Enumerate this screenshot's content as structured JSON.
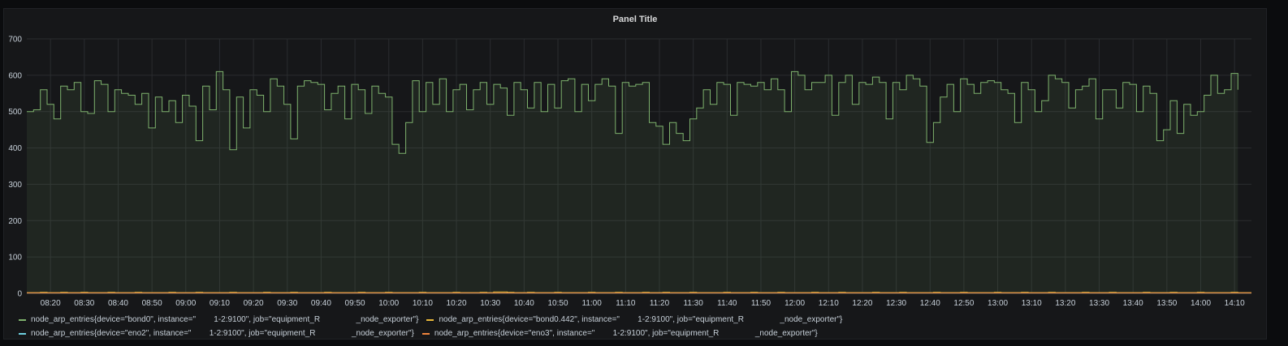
{
  "panel": {
    "title": "Panel Title"
  },
  "colors": {
    "background": "#161719",
    "grid": "#2a2c2f",
    "bond0": "#7eb26d",
    "bond0_442": "#eab839",
    "eno2": "#6ed0e0",
    "eno3": "#ef843c"
  },
  "chart_data": {
    "type": "line",
    "title": "Panel Title",
    "xlabel": "",
    "ylabel": "",
    "xlim": [
      "08:13",
      "14:15"
    ],
    "ylim": [
      0,
      700
    ],
    "y_ticks": [
      "0",
      "100",
      "200",
      "300",
      "400",
      "500",
      "600",
      "700"
    ],
    "x_ticks": [
      "08:20",
      "08:30",
      "08:40",
      "08:50",
      "09:00",
      "09:10",
      "09:20",
      "09:30",
      "09:40",
      "09:50",
      "10:00",
      "10:10",
      "10:20",
      "10:30",
      "10:40",
      "10:50",
      "11:00",
      "11:10",
      "11:20",
      "11:30",
      "11:40",
      "11:50",
      "12:00",
      "12:10",
      "12:20",
      "12:30",
      "12:40",
      "12:50",
      "13:00",
      "13:10",
      "13:20",
      "13:30",
      "13:40",
      "13:50",
      "14:00",
      "14:10"
    ],
    "grid": true,
    "legend_position": "bottom",
    "x": [
      "08:13",
      "08:15",
      "08:17",
      "08:19",
      "08:21",
      "08:23",
      "08:25",
      "08:27",
      "08:29",
      "08:31",
      "08:33",
      "08:35",
      "08:37",
      "08:39",
      "08:41",
      "08:43",
      "08:45",
      "08:47",
      "08:49",
      "08:51",
      "08:53",
      "08:55",
      "08:57",
      "08:59",
      "09:01",
      "09:03",
      "09:05",
      "09:07",
      "09:09",
      "09:11",
      "09:13",
      "09:15",
      "09:17",
      "09:19",
      "09:21",
      "09:23",
      "09:25",
      "09:27",
      "09:29",
      "09:31",
      "09:33",
      "09:35",
      "09:37",
      "09:39",
      "09:41",
      "09:43",
      "09:45",
      "09:47",
      "09:49",
      "09:51",
      "09:53",
      "09:55",
      "09:57",
      "09:59",
      "10:01",
      "10:03",
      "10:05",
      "10:07",
      "10:09",
      "10:11",
      "10:13",
      "10:15",
      "10:17",
      "10:19",
      "10:21",
      "10:23",
      "10:25",
      "10:27",
      "10:29",
      "10:31",
      "10:33",
      "10:35",
      "10:37",
      "10:39",
      "10:41",
      "10:43",
      "10:45",
      "10:47",
      "10:49",
      "10:51",
      "10:53",
      "10:55",
      "10:57",
      "10:59",
      "11:01",
      "11:03",
      "11:05",
      "11:07",
      "11:09",
      "11:11",
      "11:13",
      "11:15",
      "11:17",
      "11:19",
      "11:21",
      "11:23",
      "11:25",
      "11:27",
      "11:29",
      "11:31",
      "11:33",
      "11:35",
      "11:37",
      "11:39",
      "11:41",
      "11:43",
      "11:45",
      "11:47",
      "11:49",
      "11:51",
      "11:53",
      "11:55",
      "11:57",
      "11:59",
      "12:01",
      "12:03",
      "12:05",
      "12:07",
      "12:09",
      "12:11",
      "12:13",
      "12:15",
      "12:17",
      "12:19",
      "12:21",
      "12:23",
      "12:25",
      "12:27",
      "12:29",
      "12:31",
      "12:33",
      "12:35",
      "12:37",
      "12:39",
      "12:41",
      "12:43",
      "12:45",
      "12:47",
      "12:49",
      "12:51",
      "12:53",
      "12:55",
      "12:57",
      "12:59",
      "13:01",
      "13:03",
      "13:05",
      "13:07",
      "13:09",
      "13:11",
      "13:13",
      "13:15",
      "13:17",
      "13:19",
      "13:21",
      "13:23",
      "13:25",
      "13:27",
      "13:29",
      "13:31",
      "13:33",
      "13:35",
      "13:37",
      "13:39",
      "13:41",
      "13:43",
      "13:45",
      "13:47",
      "13:49",
      "13:51",
      "13:53",
      "13:55",
      "13:57",
      "13:59",
      "14:01",
      "14:03",
      "14:05",
      "14:07",
      "14:09",
      "14:11",
      "14:13",
      "14:15"
    ],
    "series": [
      {
        "name": "node_arp_entries{device=\"bond0\", instance=\"        1-2:9100\", job=\"equipment_R                _node_exporter\"}",
        "color": "#7eb26d",
        "fill": true,
        "values": [
          500,
          505,
          560,
          520,
          480,
          570,
          560,
          580,
          500,
          495,
          585,
          575,
          500,
          560,
          550,
          545,
          520,
          550,
          455,
          540,
          500,
          530,
          470,
          545,
          515,
          420,
          570,
          505,
          610,
          560,
          395,
          540,
          455,
          560,
          545,
          500,
          590,
          570,
          520,
          425,
          570,
          585,
          580,
          575,
          505,
          550,
          570,
          480,
          575,
          560,
          495,
          570,
          550,
          540,
          410,
          385,
          470,
          585,
          500,
          580,
          520,
          590,
          500,
          560,
          575,
          505,
          560,
          580,
          520,
          575,
          565,
          490,
          580,
          560,
          510,
          580,
          500,
          575,
          510,
          585,
          590,
          500,
          575,
          530,
          575,
          590,
          570,
          440,
          580,
          570,
          575,
          580,
          470,
          460,
          410,
          470,
          440,
          420,
          480,
          510,
          560,
          520,
          580,
          575,
          490,
          580,
          575,
          570,
          580,
          560,
          590,
          560,
          500,
          610,
          600,
          560,
          580,
          580,
          600,
          490,
          580,
          600,
          520,
          580,
          575,
          595,
          580,
          480,
          580,
          560,
          600,
          590,
          570,
          415,
          470,
          540,
          575,
          500,
          590,
          575,
          550,
          580,
          585,
          580,
          560,
          550,
          470,
          580,
          560,
          500,
          530,
          600,
          590,
          580,
          510,
          560,
          570,
          590,
          480,
          560,
          560,
          510,
          580,
          575,
          500,
          570,
          550,
          420,
          450,
          530,
          440,
          520,
          490,
          500,
          545,
          600,
          550,
          560,
          605,
          560
        ]
      },
      {
        "name": "node_arp_entries{device=\"bond0.442\", instance=\"        1-2:9100\", job=\"equipment_R                _node_exporter\"}",
        "color": "#eab839",
        "fill": false,
        "values": [
          2,
          2,
          3,
          2,
          2,
          3,
          2,
          2,
          3,
          2,
          2,
          2,
          3,
          2,
          2,
          2,
          3,
          2,
          2,
          2,
          2,
          3,
          2,
          2,
          2,
          3,
          2,
          2,
          2,
          2,
          3,
          2,
          2,
          2,
          2,
          3,
          2,
          2,
          2,
          3,
          2,
          2,
          2,
          2,
          3,
          2,
          2,
          2,
          2,
          3,
          2,
          2,
          2,
          3,
          2,
          2,
          2,
          2,
          3,
          2,
          2,
          2,
          2,
          3,
          2,
          2,
          2,
          3,
          2,
          4,
          4,
          3,
          2,
          2,
          3,
          2,
          2,
          2,
          3,
          2,
          2,
          2,
          2,
          3,
          2,
          2,
          2,
          3,
          2,
          2,
          2,
          3,
          2,
          2,
          3,
          2,
          2,
          2,
          3,
          2,
          2,
          2,
          2,
          3,
          2,
          2,
          2,
          3,
          2,
          2,
          2,
          3,
          2,
          2,
          2,
          2,
          3,
          2,
          2,
          2,
          3,
          2,
          2,
          2,
          2,
          3,
          2,
          2,
          2,
          3,
          2,
          2,
          2,
          2,
          3,
          2,
          2,
          2,
          3,
          2,
          2,
          2,
          2,
          3,
          2,
          2,
          2,
          3,
          2,
          2,
          2,
          3,
          2,
          2,
          2,
          2,
          3,
          2,
          2,
          2,
          3,
          2,
          2,
          2,
          2,
          3,
          2,
          2,
          2,
          3,
          2,
          2,
          2,
          3,
          2,
          2,
          2,
          2,
          3,
          2,
          2,
          2
        ]
      },
      {
        "name": "node_arp_entries{device=\"eno2\", instance=\"        1-2:9100\", job=\"equipment_R                _node_exporter\"}",
        "color": "#6ed0e0",
        "fill": false,
        "values": [
          1,
          1,
          1,
          1,
          1,
          1,
          1,
          1,
          1,
          1,
          1,
          1,
          1,
          1,
          1,
          1,
          1,
          1,
          1,
          1,
          1,
          1,
          1,
          1,
          1,
          1,
          1,
          1,
          1,
          1,
          1,
          1,
          1,
          1,
          1,
          1,
          1,
          1,
          1,
          1,
          1,
          1,
          1,
          1,
          1,
          1,
          1,
          1,
          1,
          1,
          1,
          1,
          1,
          1,
          1,
          1,
          1,
          1,
          1,
          1,
          1,
          1,
          1,
          1,
          1,
          1,
          1,
          1,
          1,
          1,
          1,
          1,
          1,
          1,
          1,
          1,
          1,
          1,
          1,
          1,
          1,
          1,
          1,
          1,
          1,
          1,
          1,
          1,
          1,
          1,
          1,
          1,
          1,
          1,
          1,
          1,
          1,
          1,
          1,
          1,
          1,
          1,
          1,
          1,
          1,
          1,
          1,
          1,
          1,
          1,
          1,
          1,
          1,
          1,
          1,
          1,
          1,
          1,
          1,
          1,
          1,
          1,
          1,
          1,
          1,
          1,
          1,
          1,
          1,
          1,
          1,
          1,
          1,
          1,
          1,
          1,
          1,
          1,
          1,
          1,
          1,
          1,
          1,
          1,
          1,
          1,
          1,
          1,
          1,
          1,
          1,
          1,
          1,
          1,
          1,
          1,
          1,
          1,
          1,
          1,
          1,
          1,
          1,
          1,
          1,
          1,
          1,
          1,
          1,
          1,
          1,
          1,
          1,
          1,
          1,
          1,
          1,
          1,
          1,
          1,
          1,
          1
        ]
      },
      {
        "name": "node_arp_entries{device=\"eno3\", instance=\"        1-2:9100\", job=\"equipment_R                _node_exporter\"}",
        "color": "#ef843c",
        "fill": false,
        "values": [
          1,
          1,
          1,
          1,
          1,
          1,
          1,
          1,
          1,
          1,
          1,
          1,
          1,
          1,
          1,
          1,
          1,
          1,
          1,
          1,
          1,
          1,
          1,
          1,
          1,
          1,
          1,
          1,
          1,
          1,
          1,
          1,
          1,
          1,
          1,
          1,
          1,
          1,
          1,
          1,
          1,
          1,
          1,
          1,
          1,
          1,
          1,
          1,
          1,
          1,
          1,
          1,
          1,
          1,
          1,
          1,
          1,
          1,
          1,
          1,
          1,
          1,
          1,
          1,
          1,
          1,
          1,
          1,
          1,
          1,
          1,
          1,
          1,
          1,
          1,
          1,
          1,
          1,
          1,
          1,
          1,
          1,
          1,
          1,
          1,
          1,
          1,
          1,
          1,
          1,
          1,
          1,
          1,
          1,
          1,
          1,
          1,
          1,
          1,
          1,
          1,
          1,
          1,
          1,
          1,
          1,
          1,
          1,
          1,
          1,
          1,
          1,
          1,
          1,
          1,
          1,
          1,
          1,
          1,
          1,
          1,
          1,
          1,
          1,
          1,
          1,
          1,
          1,
          1,
          1,
          1,
          1,
          1,
          1,
          1,
          1,
          1,
          1,
          1,
          1,
          1,
          1,
          1,
          1,
          1,
          1,
          1,
          1,
          1,
          1,
          1,
          1,
          1,
          1,
          1,
          1,
          1,
          1,
          1,
          1,
          1,
          1,
          1,
          1,
          1,
          1,
          1,
          1,
          1,
          1,
          1,
          1,
          1,
          1,
          1,
          1,
          1,
          1,
          1,
          1,
          1,
          1
        ]
      }
    ]
  }
}
